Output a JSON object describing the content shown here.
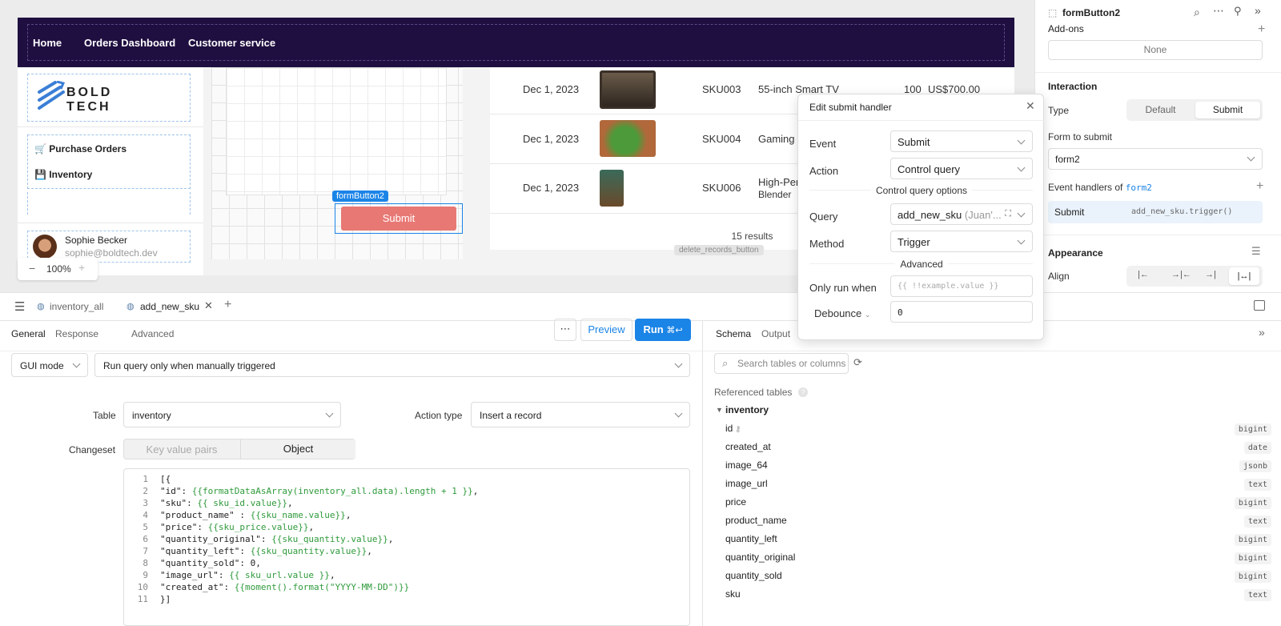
{
  "app": {
    "nav": {
      "home": "Home",
      "orders": "Orders Dashboard",
      "service": "Customer service"
    },
    "sidebar": {
      "logo_line1": "BOLD",
      "logo_line2": "TECH",
      "items": [
        {
          "label": "Purchase Orders",
          "icon": "cart-icon"
        },
        {
          "label": "Inventory",
          "icon": "floppy-icon"
        }
      ],
      "user": {
        "name": "Sophie Becker",
        "email": "sophie@boldtech.dev"
      }
    },
    "zoom": "100%",
    "form_button": {
      "tag": "formButton2",
      "label": "Submit"
    },
    "table": {
      "rows": [
        {
          "date": "Dec 1, 2023",
          "sku": "SKU003",
          "name": "55-inch Smart TV",
          "qty": "100",
          "price": "US$700.00"
        },
        {
          "date": "Dec 1, 2023",
          "sku": "SKU004",
          "name": "Gaming C",
          "qty": "",
          "price": ""
        },
        {
          "date": "Dec 1, 2023",
          "sku": "SKU006",
          "name": "High-Perf",
          "name2": "Blender",
          "qty": "",
          "price": ""
        }
      ],
      "results": "15 results",
      "hidden_tag": "delete_records_button"
    }
  },
  "inspector": {
    "title": "formButton2",
    "addons_label": "Add-ons",
    "addons_value": "None",
    "interaction": "Interaction",
    "type_label": "Type",
    "type_options": [
      "Default",
      "Submit"
    ],
    "type_selected": "Submit",
    "form_label": "Form to submit",
    "form_value": "form2",
    "handlers_label": "Event handlers of",
    "handlers_form": "form2",
    "handler": {
      "event": "Submit",
      "action": "add_new_sku.trigger()"
    },
    "appearance": "Appearance",
    "align_label": "Align"
  },
  "popover": {
    "title": "Edit submit handler",
    "event_label": "Event",
    "event_value": "Submit",
    "action_label": "Action",
    "action_value": "Control query",
    "options_heading": "Control query options",
    "query_label": "Query",
    "query_value": "add_new_sku",
    "query_owner": "(Juan'...",
    "method_label": "Method",
    "method_value": "Trigger",
    "advanced_heading": "Advanced",
    "only_run_label": "Only run when",
    "only_run_placeholder": "{{ !!example.value }}",
    "debounce_label": "Debounce",
    "debounce_value": "0"
  },
  "tabs": [
    {
      "label": "inventory_all",
      "active": false
    },
    {
      "label": "add_new_sku",
      "active": true
    }
  ],
  "query": {
    "subtabs": [
      "General",
      "Response",
      "Advanced"
    ],
    "preview": "Preview",
    "run": "Run",
    "run_shortcut": "⌘↩",
    "mode": "GUI mode",
    "trigger": "Run query only when manually triggered",
    "table_label": "Table",
    "table_value": "inventory",
    "action_type_label": "Action type",
    "action_type_value": "Insert a record",
    "changeset_label": "Changeset",
    "changeset_options": [
      "Key value pairs",
      "Object"
    ],
    "code_lines": [
      "[{",
      "\"id\": {{formatDataAsArray(inventory_all.data).length + 1 }},",
      "\"sku\": {{ sku_id.value}},",
      "\"product_name\" : {{sku_name.value}},",
      "\"price\": {{sku_price.value}},",
      "\"quantity_original\": {{sku_quantity.value}},",
      "\"quantity_left\": {{sku_quantity.value}},",
      "\"quantity_sold\": 0,",
      "\"image_url\": {{ sku_url.value }},",
      "\"created_at\": {{moment().format(\"YYYY-MM-DD\")}}",
      "}]"
    ]
  },
  "schema": {
    "tabs": [
      "Schema",
      "Output"
    ],
    "search_placeholder": "Search tables or columns",
    "referenced": "Referenced tables",
    "table": "inventory",
    "columns": [
      {
        "name": "id",
        "type": "bigint"
      },
      {
        "name": "created_at",
        "type": "date"
      },
      {
        "name": "image_64",
        "type": "jsonb"
      },
      {
        "name": "image_url",
        "type": "text"
      },
      {
        "name": "price",
        "type": "bigint"
      },
      {
        "name": "product_name",
        "type": "text"
      },
      {
        "name": "quantity_left",
        "type": "bigint"
      },
      {
        "name": "quantity_original",
        "type": "bigint"
      },
      {
        "name": "quantity_sold",
        "type": "bigint"
      },
      {
        "name": "sku",
        "type": "text"
      }
    ]
  },
  "colors": {
    "accent": "#1b84e7",
    "nav": "#1f0f40",
    "submit": "#e87874"
  }
}
